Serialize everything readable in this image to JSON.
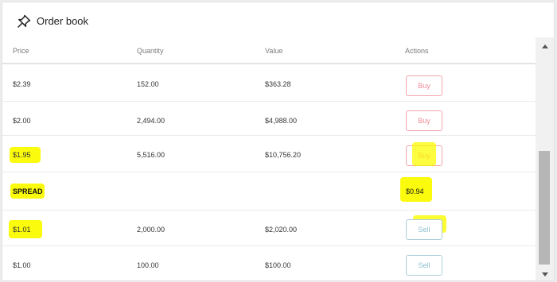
{
  "header": {
    "title": "Order book",
    "icon": "pin-icon"
  },
  "columns": {
    "price": "Price",
    "quantity": "Quantity",
    "value": "Value",
    "actions": "Actions"
  },
  "asks": [
    {
      "price": "$2.39",
      "quantity": "152.00",
      "value": "$363.28",
      "action": "Buy"
    },
    {
      "price": "$2.00",
      "quantity": "2,494.00",
      "value": "$4,988.00",
      "action": "Buy"
    },
    {
      "price": "$1.95",
      "quantity": "5,516.00",
      "value": "$10,756.20",
      "action": "Buy"
    }
  ],
  "spread": {
    "label": "SPREAD",
    "value": "$0.94"
  },
  "bids": [
    {
      "price": "$1.01",
      "quantity": "2,000.00",
      "value": "$2,020.00",
      "action": "Sell"
    },
    {
      "price": "$1.00",
      "quantity": "100.00",
      "value": "$100.00",
      "action": "Sell"
    }
  ],
  "colors": {
    "buy_border": "#f2a4ad",
    "sell_border": "#aecfd9",
    "highlight": "#fbfb00"
  }
}
